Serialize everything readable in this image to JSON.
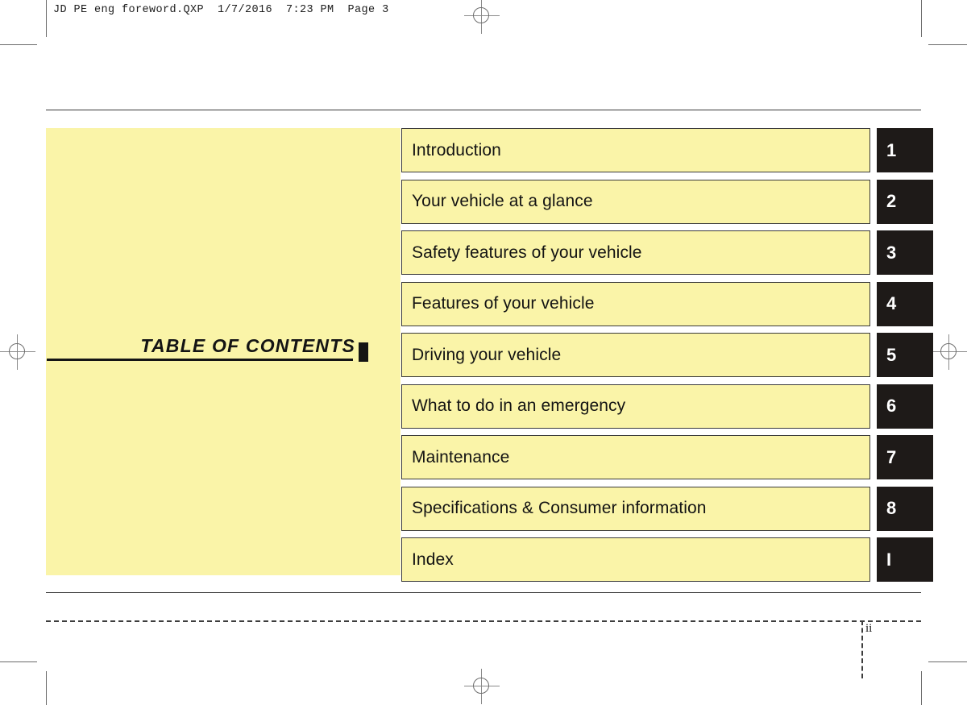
{
  "header": {
    "slug": "JD PE eng foreword.QXP  1/7/2016  7:23 PM  Page 3"
  },
  "panel": {
    "title": "TABLE  OF  CONTENTS"
  },
  "toc": {
    "rows": [
      {
        "label": "Introduction",
        "tab": "1"
      },
      {
        "label": "Your vehicle at a glance",
        "tab": "2"
      },
      {
        "label": "Safety features of your vehicle",
        "tab": "3"
      },
      {
        "label": "Features of your vehicle",
        "tab": "4"
      },
      {
        "label": "Driving your vehicle",
        "tab": "5"
      },
      {
        "label": "What to do in an emergency",
        "tab": "6"
      },
      {
        "label": "Maintenance",
        "tab": "7"
      },
      {
        "label": "Specifications & Consumer information",
        "tab": "8"
      },
      {
        "label": "Index",
        "tab": "I"
      }
    ]
  },
  "footer": {
    "folio": "ii"
  },
  "colors": {
    "panel_yellow": "#faf4a8",
    "tab_black": "#1e1a18",
    "rule": "#3a3a3a",
    "text": "#131313"
  }
}
